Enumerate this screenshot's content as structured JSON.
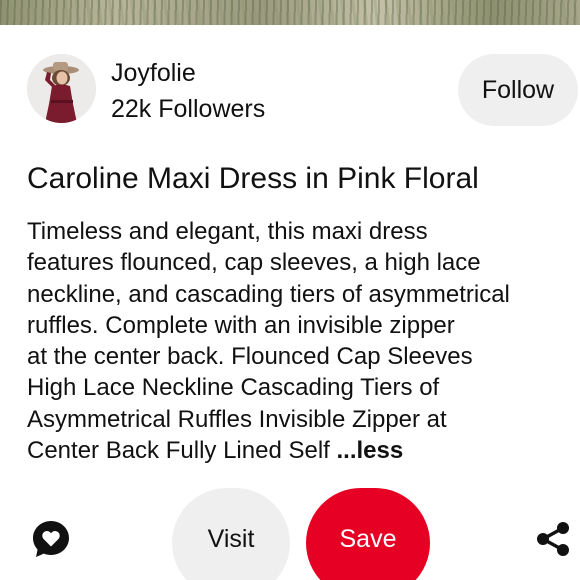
{
  "creator": {
    "name": "Joyfolie",
    "followers": "22k Followers",
    "follow_label": "Follow"
  },
  "pin": {
    "title": "Caroline Maxi Dress in Pink Floral",
    "description_lines": [
      "Timeless and elegant, this maxi dress",
      "features flounced, cap sleeves, a high lace",
      "neckline, and cascading tiers of asymmetrical",
      "ruffles. Complete with an invisible zipper",
      "at the center back. Flounced Cap Sleeves",
      "High Lace Neckline Cascading Tiers of",
      "Asymmetrical Ruffles Invisible Zipper at",
      "Center Back Fully Lined Self "
    ],
    "less_label": "...less"
  },
  "actions": {
    "visit_label": "Visit",
    "save_label": "Save",
    "comment_icon": "comment-heart-icon",
    "share_icon": "share-icon"
  },
  "colors": {
    "save_red": "#e60023",
    "button_gray": "#efefef",
    "text": "#111111"
  }
}
